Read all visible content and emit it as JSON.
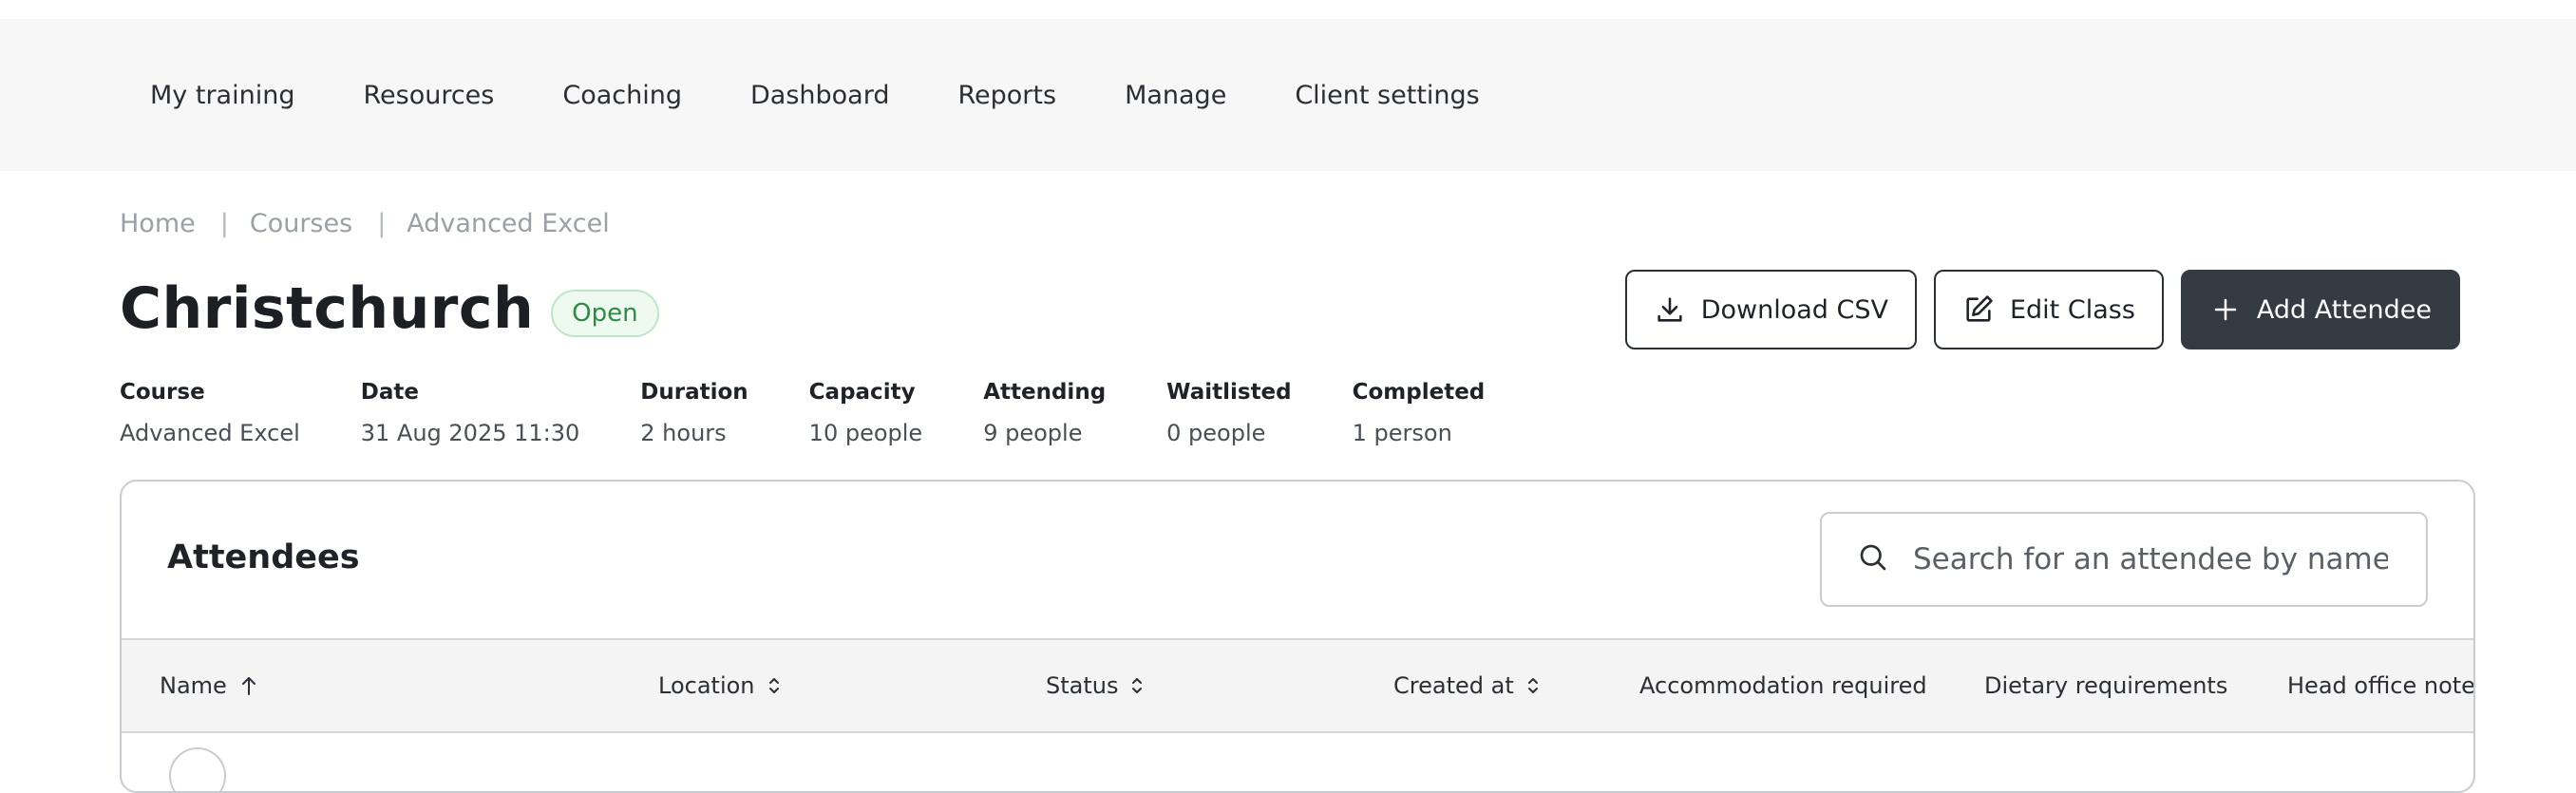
{
  "nav": {
    "items": [
      "My training",
      "Resources",
      "Coaching",
      "Dashboard",
      "Reports",
      "Manage",
      "Client settings"
    ]
  },
  "breadcrumb": {
    "home": "Home",
    "courses": "Courses",
    "current": "Advanced Excel",
    "separator": "|"
  },
  "page": {
    "title": "Christchurch",
    "status": "Open"
  },
  "actions": {
    "download_csv": "Download CSV",
    "edit_class": "Edit Class",
    "add_attendee": "Add Attendee"
  },
  "meta": [
    {
      "label": "Course",
      "value": "Advanced Excel"
    },
    {
      "label": "Date",
      "value": "31 Aug 2025 11:30"
    },
    {
      "label": "Duration",
      "value": "2 hours"
    },
    {
      "label": "Capacity",
      "value": "10 people"
    },
    {
      "label": "Attending",
      "value": "9 people"
    },
    {
      "label": "Waitlisted",
      "value": "0 people"
    },
    {
      "label": "Completed",
      "value": "1 person"
    }
  ],
  "attendees": {
    "title": "Attendees",
    "search_placeholder": "Search for an attendee by name",
    "columns": [
      "Name",
      "Location",
      "Status",
      "Created at",
      "Accommodation required",
      "Dietary requirements",
      "Head office notes"
    ]
  },
  "colors": {
    "primary_button": "#353b42",
    "status_open_text": "#2f8a46",
    "status_open_bg": "#eef9f0"
  }
}
